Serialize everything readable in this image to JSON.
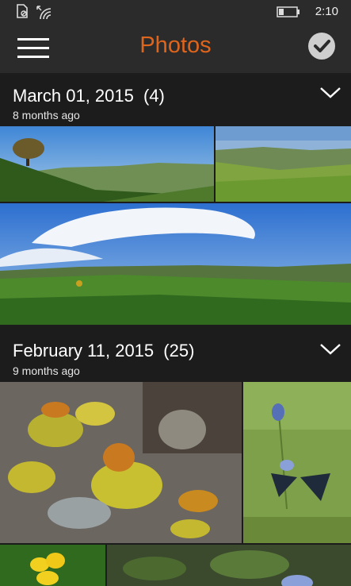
{
  "status_bar": {
    "time": "2:10",
    "icons": [
      "sim-icon",
      "wifi-icon",
      "battery-icon"
    ]
  },
  "app_bar": {
    "title": "Photos",
    "menu_icon": "hamburger-icon",
    "select_icon": "checkmark-icon",
    "title_color": "#e0651c"
  },
  "groups": [
    {
      "title": "March 01, 2015",
      "count": "(4)",
      "subtitle": "8 months ago",
      "photos": [
        "landscape-tree-hill",
        "green-valley",
        "panorama-hills-sky"
      ]
    },
    {
      "title": "February 11, 2015",
      "count": "(25)",
      "subtitle": "9 months ago",
      "photos": [
        "lichen-rock",
        "butterfly-flowers",
        "yellow-flowers",
        "blue-flower-leaves"
      ]
    }
  ]
}
